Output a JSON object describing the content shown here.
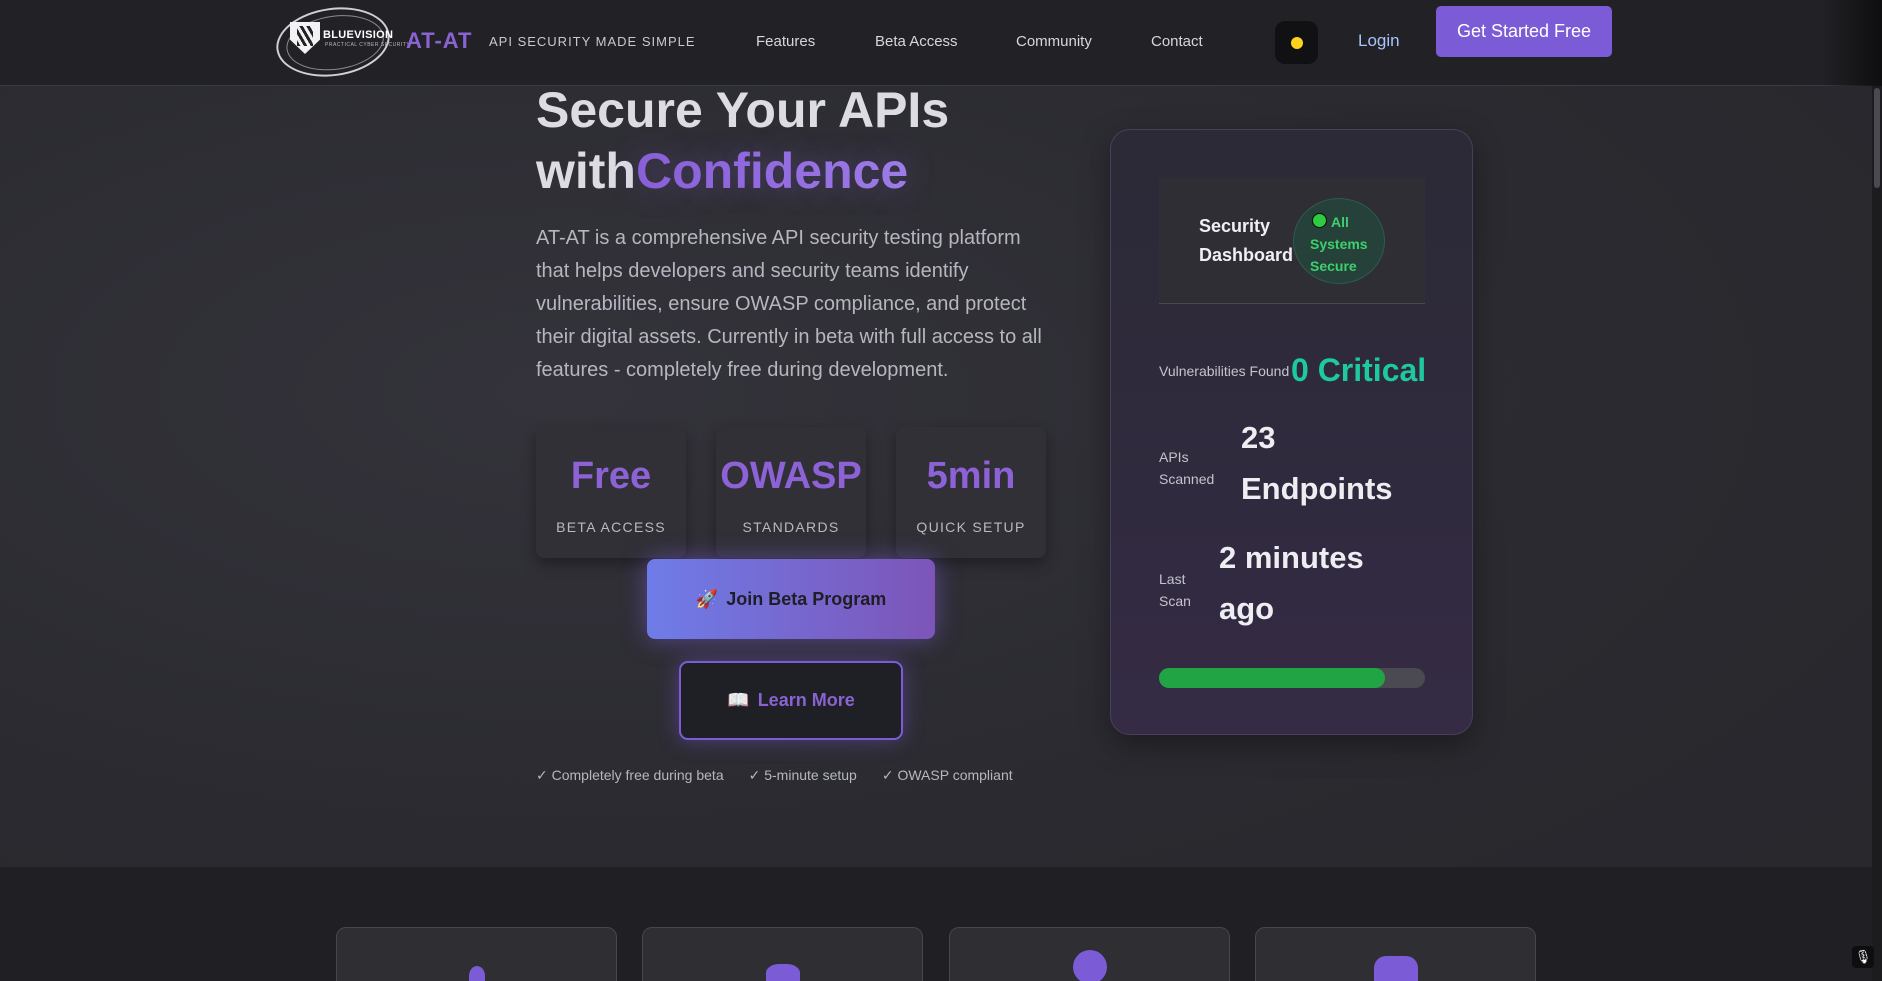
{
  "nav": {
    "logo_name": "BLUEVISION",
    "logo_sub": "PRACTICAL CYBER SECURITY",
    "brand": "AT-AT",
    "tagline": "API SECURITY MADE SIMPLE",
    "links": [
      "Features",
      "Beta Access",
      "Community",
      "Contact"
    ],
    "theme_icon": "sun-icon",
    "login": "Login",
    "cta": "Get Started Free"
  },
  "hero": {
    "title_line1": "Secure Your APIs",
    "title_line2_prefix": "with",
    "title_line2_accent": "Confidence",
    "description": "AT-AT is a comprehensive API security testing platform that helps developers and security teams identify vulnerabilities, ensure OWASP compliance, and protect their digital assets. Currently in beta with full access to all features - completely free during development.",
    "stats": [
      {
        "value": "Free",
        "label": "BETA ACCESS"
      },
      {
        "value": "OWASP",
        "label": "STANDARDS"
      },
      {
        "value": "5min",
        "label": "QUICK SETUP"
      }
    ],
    "join_button": "Join Beta Program",
    "join_icon": "rocket-icon",
    "learn_button": "Learn More",
    "learn_icon": "book-icon",
    "checks": [
      "✓ Completely free during beta",
      "✓ 5-minute setup",
      "✓ OWASP compliant"
    ]
  },
  "dashboard": {
    "title": "Security Dashboard",
    "status": "All Systems Secure",
    "vulnerabilities_label": "Vulnerabilities Found",
    "vulnerabilities_value": "0 Critical",
    "apis_label": "APIs Scanned",
    "apis_value": "23 Endpoints",
    "last_scan_label": "Last Scan",
    "last_scan_value": "2 minutes ago",
    "scan_progress": 0.85
  },
  "features": {
    "icons": [
      "rocket-icon",
      "lock-icon",
      "search-icon",
      "box-icon"
    ]
  },
  "colors": {
    "accent": "#7c5cd6",
    "secure_green": "#3ecf6e",
    "critical_teal": "#1ec9a0",
    "progress_green": "#21a544"
  }
}
